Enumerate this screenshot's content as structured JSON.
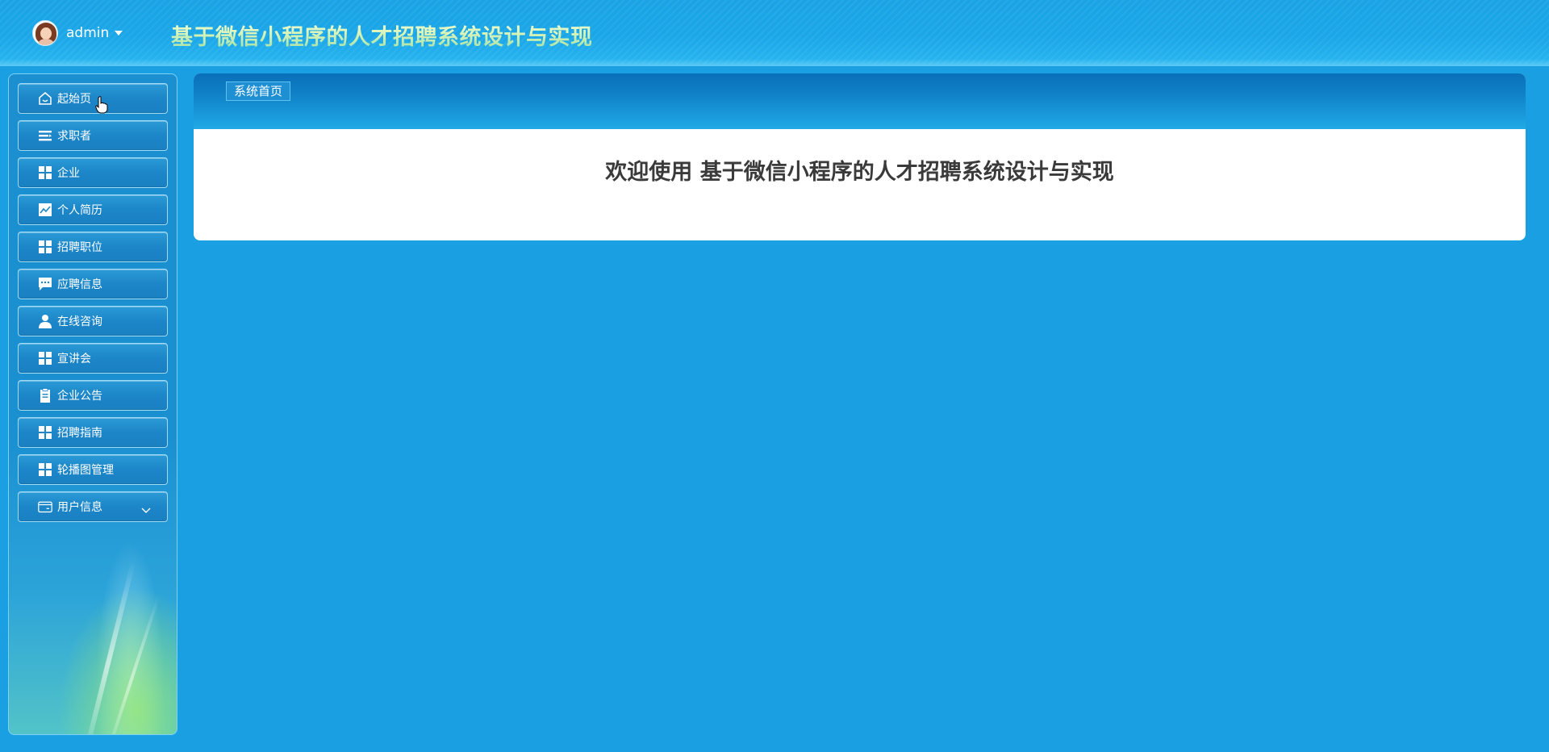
{
  "header": {
    "user_name": "admin",
    "site_title": "基于微信小程序的人才招聘系统设计与实现"
  },
  "sidebar": {
    "items": [
      {
        "label": "起始页",
        "icon": "home-icon"
      },
      {
        "label": "求职者",
        "icon": "list-icon"
      },
      {
        "label": "企业",
        "icon": "grid-icon"
      },
      {
        "label": "个人简历",
        "icon": "chart-icon"
      },
      {
        "label": "招聘职位",
        "icon": "grid-icon"
      },
      {
        "label": "应聘信息",
        "icon": "chat-icon"
      },
      {
        "label": "在线咨询",
        "icon": "user-icon"
      },
      {
        "label": "宣讲会",
        "icon": "grid-icon"
      },
      {
        "label": "企业公告",
        "icon": "clipboard-icon"
      },
      {
        "label": "招聘指南",
        "icon": "grid-icon"
      },
      {
        "label": "轮播图管理",
        "icon": "grid-icon"
      },
      {
        "label": "用户信息",
        "icon": "card-icon"
      }
    ]
  },
  "main": {
    "breadcrumb": "系统首页",
    "welcome": "欢迎使用 基于微信小程序的人才招聘系统设计与实现"
  },
  "colors": {
    "background": "#1a9fe3",
    "header": "#1ba6e8",
    "menu_item": "#1c86c8",
    "panel_head": "#0f80c6",
    "welcome_text": "#3a3a3a"
  }
}
